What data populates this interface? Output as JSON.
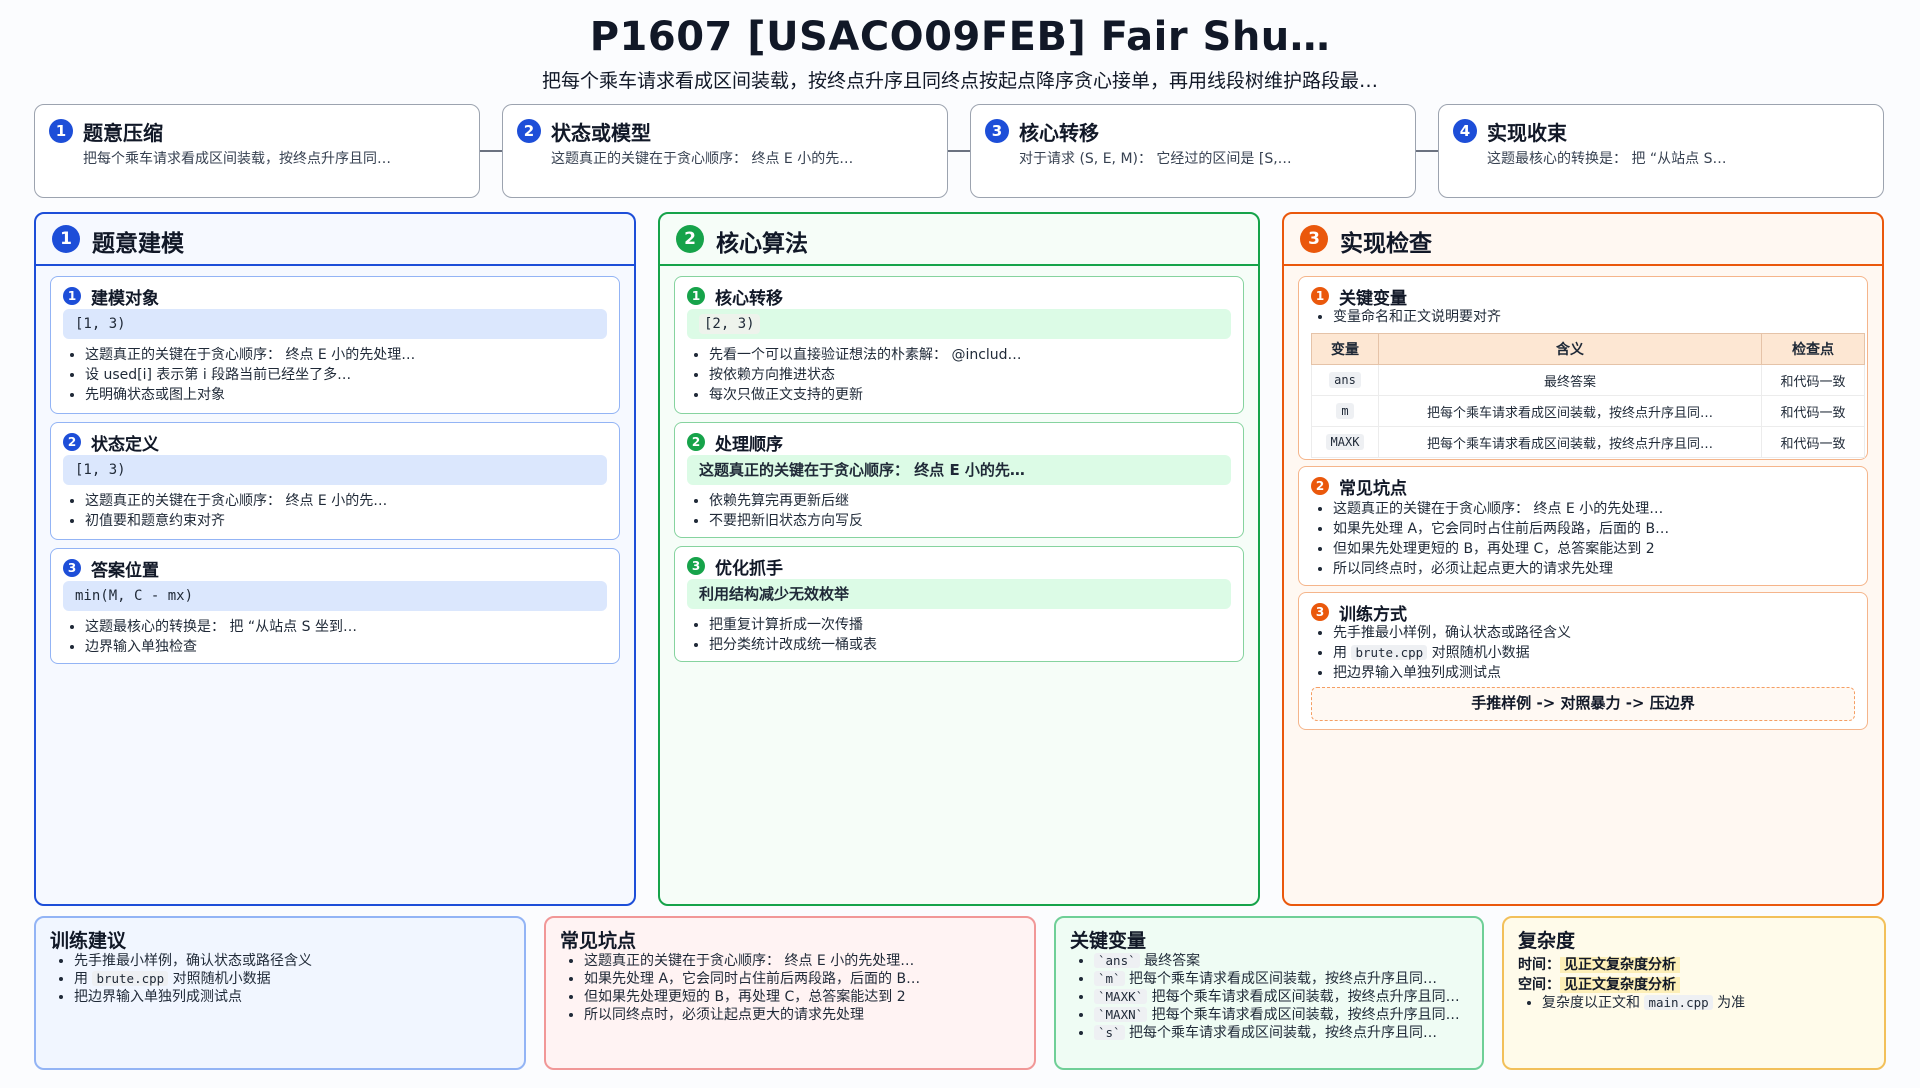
{
  "title": "P1607 [USACO09FEB] Fair Shu…",
  "subtitle": "把每个乘车请求看成区间装载，按终点升序且同终点按起点降序贪心接单，再用线段树维护路段最…",
  "steps": [
    {
      "num": "1",
      "title": "题意压缩",
      "text": "把每个乘车请求看成区间装载，按终点升序且同…"
    },
    {
      "num": "2",
      "title": "状态或模型",
      "text": "这题真正的关键在于贪心顺序： 终点 E 小的先…"
    },
    {
      "num": "3",
      "title": "核心转移",
      "text": "对于请求 (S, E, M)： 它经过的区间是 [S,…"
    },
    {
      "num": "4",
      "title": "实现收束",
      "text": "这题最核心的转换是： 把 “从站点 S…"
    }
  ],
  "columns": {
    "modeling": {
      "num": "1",
      "title": "题意建模",
      "sections": [
        {
          "num": "1",
          "title": "建模对象",
          "code": "[1, 3)",
          "bullets": [
            "这题真正的关键在于贪心顺序： 终点 E 小的先处理…",
            "设 used[i] 表示第 i 段路当前已经坐了多…",
            "先明确状态或图上对象"
          ]
        },
        {
          "num": "2",
          "title": "状态定义",
          "code": "[1, 3)",
          "bullets": [
            "这题真正的关键在于贪心顺序： 终点 E 小的先…",
            "初值要和题意约束对齐"
          ]
        },
        {
          "num": "3",
          "title": "答案位置",
          "code": "min(M, C - mx)",
          "bullets": [
            "这题最核心的转换是： 把 “从站点 S 坐到…",
            "边界输入单独检查"
          ]
        }
      ]
    },
    "algorithm": {
      "num": "2",
      "title": "核心算法",
      "sections": [
        {
          "num": "1",
          "title": "核心转移",
          "code": "[2, 3)",
          "bullets": [
            "先看一个可以直接验证想法的朴素解： @includ…",
            "按依赖方向推进状态",
            "每次只做正文支持的更新"
          ]
        },
        {
          "num": "2",
          "title": "处理顺序",
          "code": "这题真正的关键在于贪心顺序： 终点 E 小的先…",
          "bullets": [
            "依赖先算完再更新后继",
            "不要把新旧状态方向写反"
          ]
        },
        {
          "num": "3",
          "title": "优化抓手",
          "code": "利用结构减少无效枚举",
          "bullets": [
            "把重复计算折成一次传播",
            "把分类统计改成统一桶或表"
          ]
        }
      ]
    },
    "check": {
      "num": "3",
      "title": "实现检查",
      "vars": {
        "num": "1",
        "title": "关键变量",
        "note": "变量命名和正文说明要对齐",
        "headers": [
          "变量",
          "含义",
          "检查点"
        ],
        "rows": [
          [
            "ans",
            "最终答案",
            "和代码一致"
          ],
          [
            "m",
            "把每个乘车请求看成区间装载，按终点升序且同…",
            "和代码一致"
          ],
          [
            "MAXK",
            "把每个乘车请求看成区间装载，按终点升序且同…",
            "和代码一致"
          ]
        ]
      },
      "pitfalls": {
        "num": "2",
        "title": "常见坑点",
        "bullets": [
          "这题真正的关键在于贪心顺序： 终点 E 小的先处理…",
          "如果先处理 A，它会同时占住前后两段路，后面的 B…",
          "但如果先处理更短的 B，再处理 C，总答案能达到 2",
          "所以同终点时，必须让起点更大的请求先处理"
        ]
      },
      "training": {
        "num": "3",
        "title": "训练方式",
        "b1": "先手推最小样例，确认状态或路径含义",
        "b2_pre": "用 ",
        "b2_code": "brute.cpp",
        "b2_post": " 对照随机小数据",
        "b3": "把边界输入单独列成测试点",
        "flow": "手推样例 -> 对照暴力 -> 压边界"
      }
    }
  },
  "bottom": {
    "training": {
      "title": "训练建议",
      "b1": "先手推最小样例，确认状态或路径含义",
      "b2_pre": "用 ",
      "b2_code": "brute.cpp",
      "b2_post": " 对照随机小数据",
      "b3": "把边界输入单独列成测试点"
    },
    "pitfalls": {
      "title": "常见坑点",
      "bullets": [
        "这题真正的关键在于贪心顺序： 终点 E 小的先处理…",
        "如果先处理 A，它会同时占住前后两段路，后面的 B…",
        "但如果先处理更短的 B，再处理 C，总答案能达到 2",
        "所以同终点时，必须让起点更大的请求先处理"
      ]
    },
    "vars": {
      "title": "关键变量",
      "items": [
        {
          "code": "`ans`",
          "text": "最终答案"
        },
        {
          "code": "`m`",
          "text": "把每个乘车请求看成区间装载，按终点升序且同…"
        },
        {
          "code": "`MAXK`",
          "text": "把每个乘车请求看成区间装载，按终点升序且同…"
        },
        {
          "code": "`MAXN`",
          "text": "把每个乘车请求看成区间装载，按终点升序且同…"
        },
        {
          "code": "`s`",
          "text": "把每个乘车请求看成区间装载，按终点升序且同…"
        }
      ]
    },
    "complexity": {
      "title": "复杂度",
      "time_label": "时间：",
      "time_value": "见正文复杂度分析",
      "space_label": "空间：",
      "space_value": "见正文复杂度分析",
      "note_pre": "复杂度以正文和 ",
      "note_code": "main.cpp",
      "note_post": " 为准"
    }
  },
  "colors": {
    "blue": "#1d4ed8",
    "green": "#16a34a",
    "orange": "#ea580c",
    "red_border": "#f19797",
    "yellow_border": "#f2c05a"
  }
}
